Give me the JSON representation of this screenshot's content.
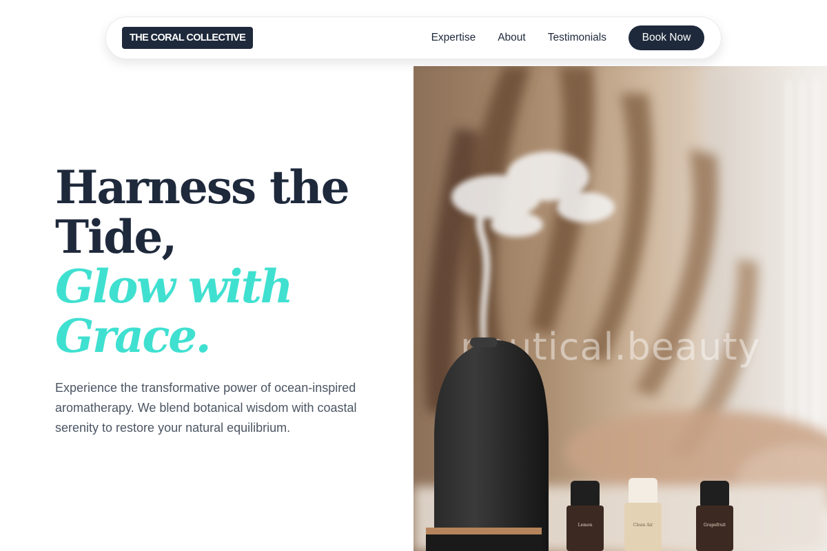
{
  "nav": {
    "logo": "THE CORAL COLLECTIVE",
    "links": [
      "Expertise",
      "About",
      "Testimonials"
    ],
    "cta": "Book Now"
  },
  "hero": {
    "title_line1": "Harness the",
    "title_line2": "Tide,",
    "accent_line1": "Glow with",
    "accent_line2": "Grace.",
    "description": "Experience the transformative power of ocean-inspired aromatherapy. We blend botanical wisdom with coastal serenity to restore your natural equilibrium.",
    "image": {
      "watermark": "nautical.beauty",
      "bottles": [
        "Lemon",
        "Clean Air",
        "Grapefruit"
      ]
    }
  },
  "colors": {
    "navy": "#1e293b",
    "turquoise": "#40e0d0",
    "body_text": "#4b5563"
  }
}
